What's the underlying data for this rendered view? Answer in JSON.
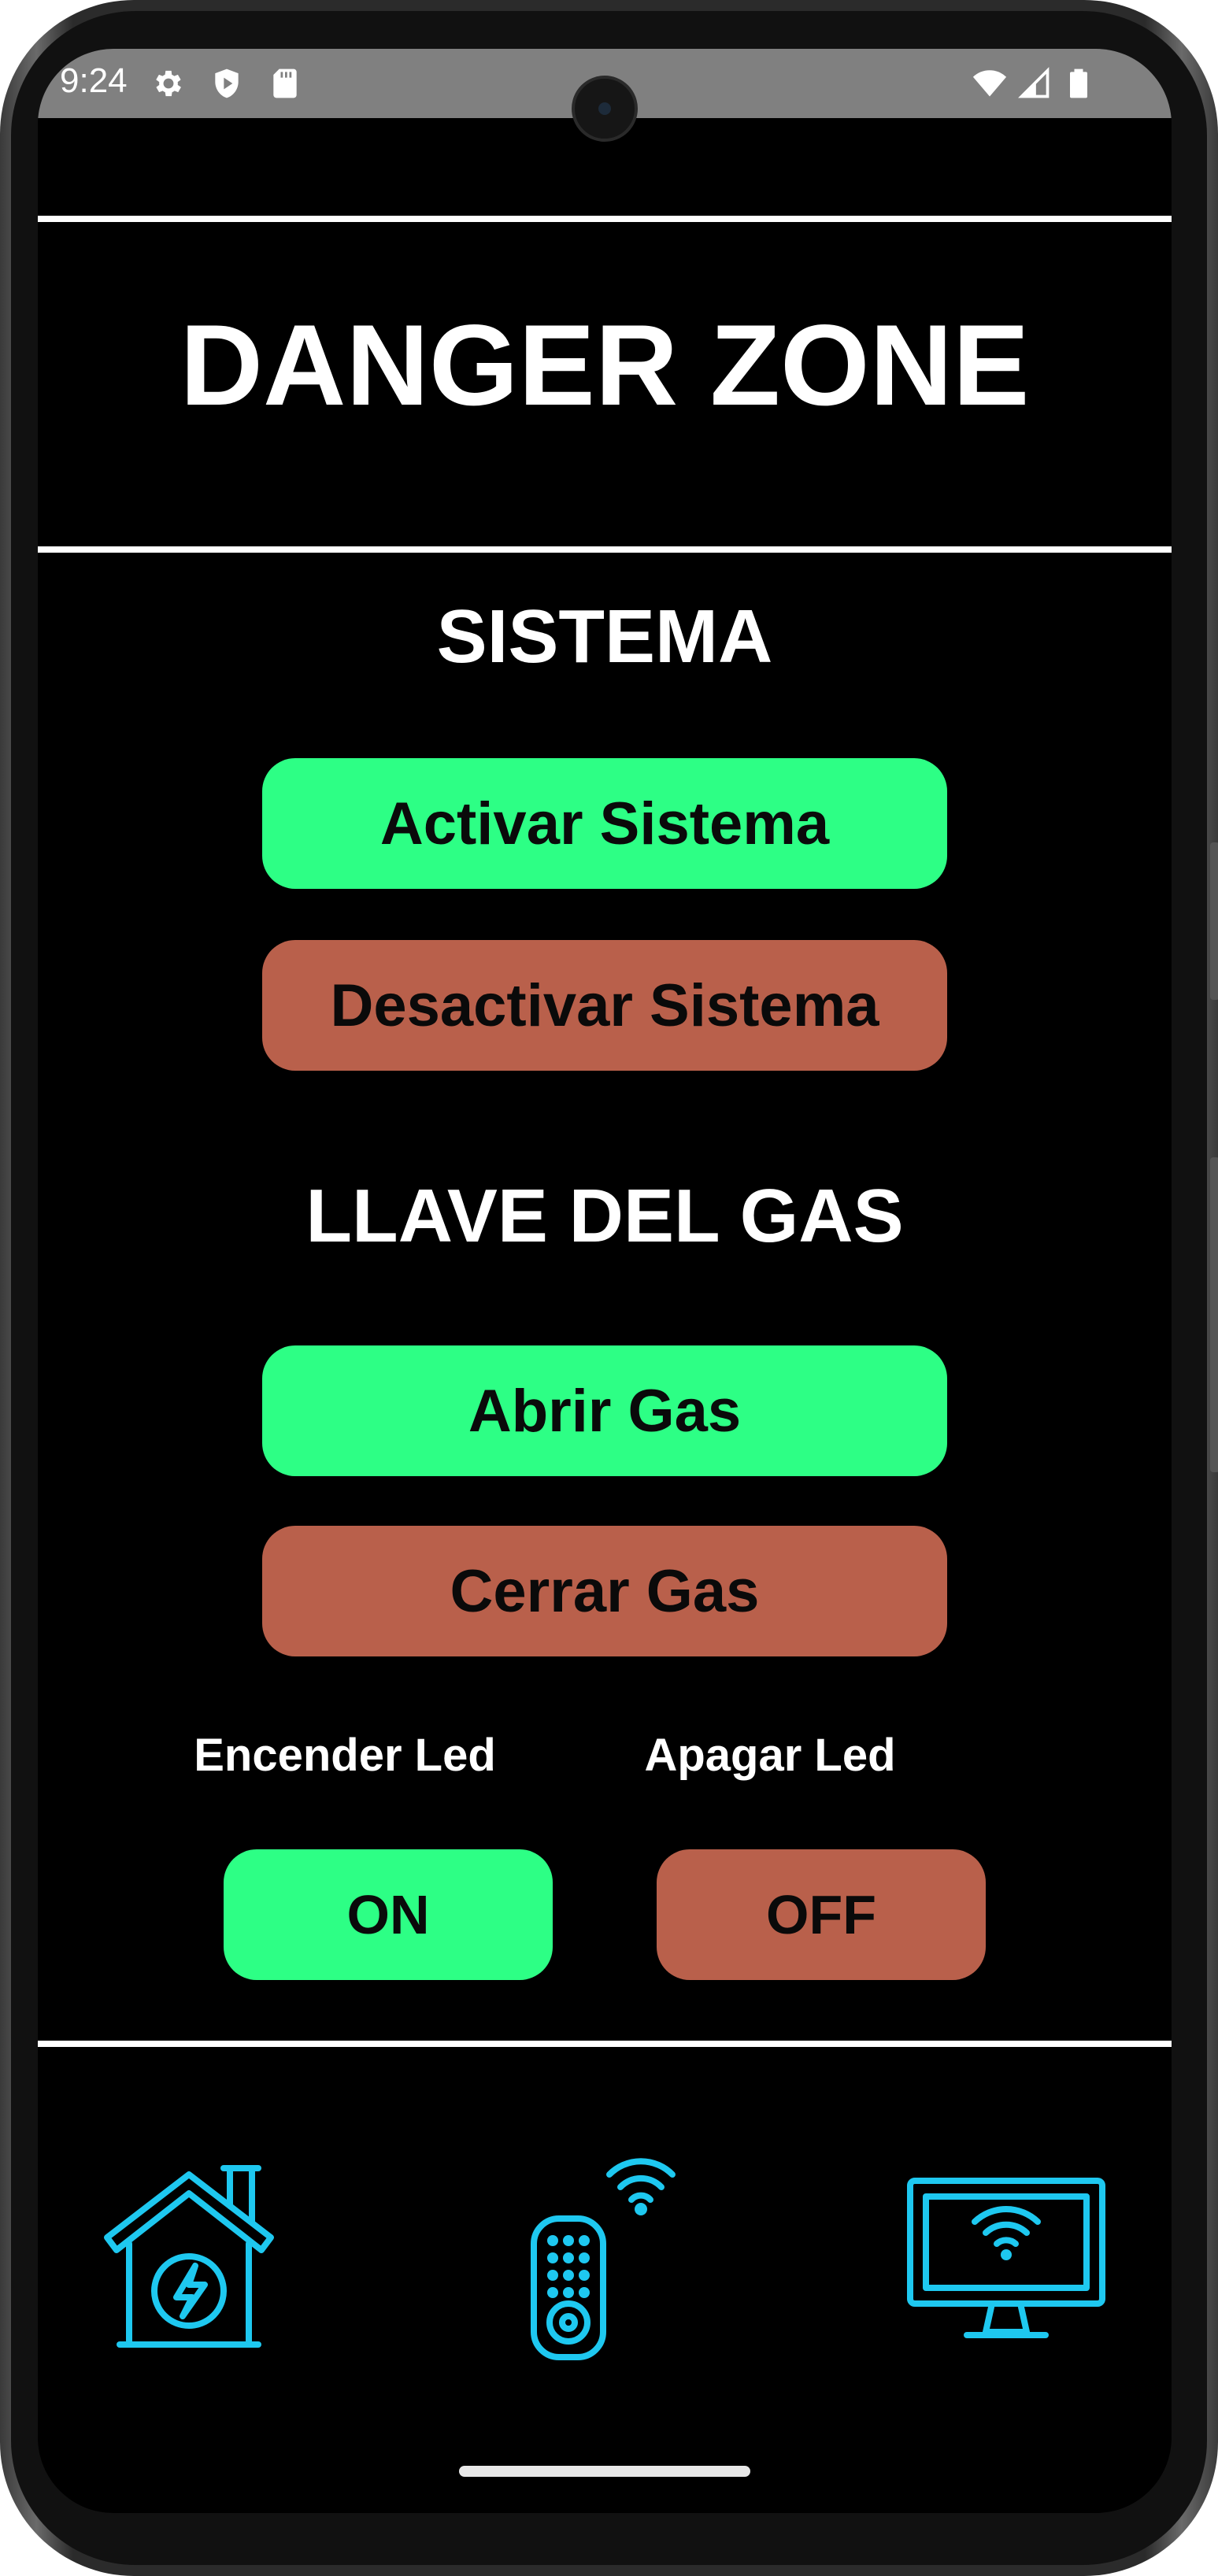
{
  "status_bar": {
    "time": "9:24",
    "left_icons": [
      "gear-icon",
      "shield-play-icon",
      "sd-card-icon"
    ],
    "right_icons": [
      "wifi-icon",
      "signal-icon",
      "battery-icon"
    ]
  },
  "header": {
    "title": "DANGER ZONE"
  },
  "sistema": {
    "heading": "SISTEMA",
    "activate_label": "Activar Sistema",
    "deactivate_label": "Desactivar Sistema"
  },
  "gas": {
    "heading": "LLAVE DEL GAS",
    "open_label": "Abrir Gas",
    "close_label": "Cerrar Gas"
  },
  "led": {
    "on_caption": "Encender Led",
    "off_caption": "Apagar Led",
    "on_label": "ON",
    "off_label": "OFF"
  },
  "bottom_nav": {
    "items": [
      "smart-home-energy-icon",
      "wifi-remote-control-icon",
      "wifi-monitor-icon"
    ]
  },
  "colors": {
    "accent_green": "#2dff85",
    "accent_red": "#b9604b",
    "icon_cyan": "#1ec8f0",
    "background": "#000000"
  }
}
